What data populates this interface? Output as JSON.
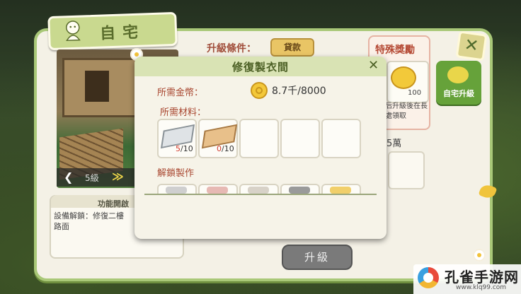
{
  "window": {
    "title": "自宅",
    "upgrade_condition_label": "升級條件：",
    "loan_label": "貸款",
    "special_reward_title": "特殊獎勵",
    "reward_count": "100",
    "reward_note": "后升級後在長處領取",
    "wan_text": "5萬",
    "upgrade_button": "升級",
    "home_upgrade_label": "自宅升級",
    "close_symbol": "✕"
  },
  "scene": {
    "level_label": "5級",
    "prev_symbol": "❮",
    "next_symbol": "≫"
  },
  "function_box": {
    "header": "功能開啟",
    "text": "設備解鎖：修復二樓\n路面"
  },
  "modal": {
    "title": "修復製衣間",
    "close_symbol": "✕",
    "cost_label": "所需金幣：",
    "cost_value": "8.7千/8000",
    "materials_label": "所需材料：",
    "materials": [
      {
        "name": "stone-slab",
        "have": "5",
        "need": "/10"
      },
      {
        "name": "wood-plank",
        "have": "0",
        "need": "/10"
      }
    ],
    "unlock_label": "解鎖製作"
  },
  "watermark": {
    "name": "孔雀手游网",
    "url": "www.klq99.com"
  },
  "colors": {
    "window_border": "#a9c878",
    "label_red": "#a8462f",
    "coin_gold": "#f3c83a"
  }
}
